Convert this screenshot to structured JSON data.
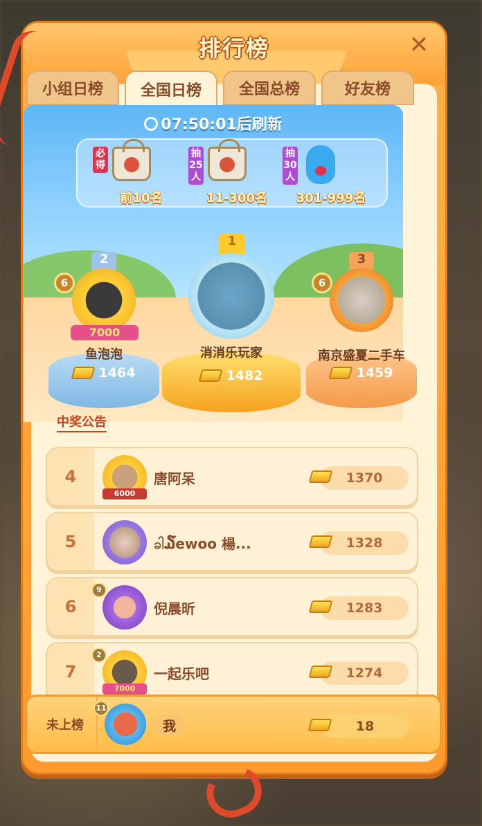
{
  "header": {
    "title": "排行榜",
    "close_icon": "close-icon"
  },
  "tabs": [
    {
      "label": "小组日榜",
      "active": false
    },
    {
      "label": "全国日榜",
      "active": true
    },
    {
      "label": "全国总榜",
      "active": false
    },
    {
      "label": "好友榜",
      "active": false
    }
  ],
  "timer": {
    "time": "07:50:01",
    "suffix": "后刷新"
  },
  "prizes": [
    {
      "tag": "必得",
      "range": "前10名",
      "item": "bag"
    },
    {
      "tag": "抽25人",
      "range": "11-300名",
      "item": "bag"
    },
    {
      "tag": "抽30人",
      "range": "301-999名",
      "item": "bear"
    }
  ],
  "podium": [
    {
      "rank": "2",
      "name": "鱼泡泡",
      "score": "1464",
      "level": "6",
      "badge": "7000"
    },
    {
      "rank": "1",
      "name": "消消乐玩家",
      "score": "1482"
    },
    {
      "rank": "3",
      "name": "南京盛夏二手车",
      "score": "1459",
      "level": "6"
    }
  ],
  "announce": "中奖公告",
  "rows": [
    {
      "rank": "4",
      "name": "唐阿呆",
      "score": "1370",
      "badge": "6000"
    },
    {
      "rank": "5",
      "name": "ခါ໓ewoo 楊...",
      "score": "1328"
    },
    {
      "rank": "6",
      "name": "倪晨昕",
      "score": "1283",
      "level": "9"
    },
    {
      "rank": "7",
      "name": "一起乐吧",
      "score": "1274",
      "level": "2",
      "badge": "7000"
    }
  ],
  "me": {
    "status": "未上榜",
    "name": "我",
    "score": "18",
    "level": "11"
  },
  "colors": {
    "panel": "#ff9a2e",
    "accent": "#e0482a",
    "gold": "#f0a81a"
  }
}
